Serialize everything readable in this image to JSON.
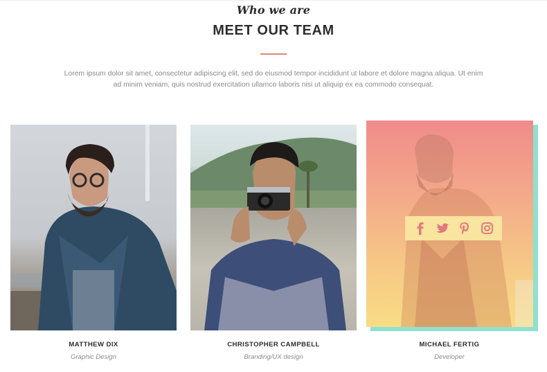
{
  "section": {
    "kicker": "Who we are",
    "title": "MEET OUR TEAM",
    "intro": "Lorem ipsum dolor sit amet, consectetur adipiscing elit, sed do eiusmod tempor incididunt ut labore et dolore magna aliqua. Ut enim ad minim veniam, quis nostrud exercitation ullamco laboris nisi ut aliquip ex ea commodo consequat.",
    "accent_color": "#e2837f"
  },
  "team": [
    {
      "name": "MATTHEW DIX",
      "role": "Graphic Design"
    },
    {
      "name": "CHRISTOPHER CAMPBELL",
      "role": "Branding/UX design"
    },
    {
      "name": "MICHAEL FERTIG",
      "role": "Developer"
    }
  ],
  "social_icons": [
    "facebook-icon",
    "twitter-icon",
    "pinterest-icon",
    "instagram-icon"
  ],
  "colors": {
    "overlay_top": "#f08b8a",
    "overlay_bottom": "#f8dc85",
    "shadow_plate": "#8fe0cf",
    "social_bar": "#f9e4a0",
    "social_icon": "#e5787d"
  }
}
